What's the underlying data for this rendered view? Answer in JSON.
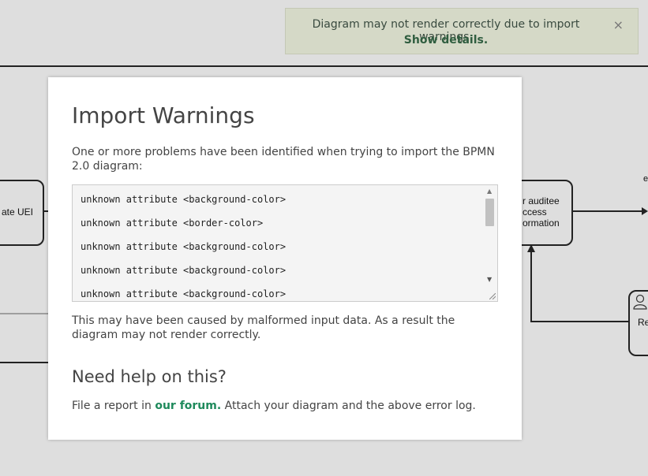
{
  "notification": {
    "message": "Diagram may not render correctly due to import warnings.",
    "link": "Show details.",
    "close": "×"
  },
  "diagram": {
    "left_task_label": "ate UEI",
    "right_task_lines": [
      "r auditee",
      "ccess",
      "ormation"
    ],
    "user_task_label": "Re",
    "edge_label": "e"
  },
  "modal": {
    "title": "Import Warnings",
    "intro": "One or more problems have been identified when trying to import the BPMN 2.0 diagram:",
    "log_lines": [
      "unknown attribute <background-color>",
      "unknown attribute <border-color>",
      "unknown attribute <background-color>",
      "unknown attribute <background-color>",
      "unknown attribute <background-color>"
    ],
    "cause": "This may have been caused by malformed input data. As a result the diagram may not render correctly.",
    "help_title": "Need help on this?",
    "report_prefix": "File a report in ",
    "report_link": "our forum.",
    "report_suffix": " Attach your diagram and the above error log."
  }
}
